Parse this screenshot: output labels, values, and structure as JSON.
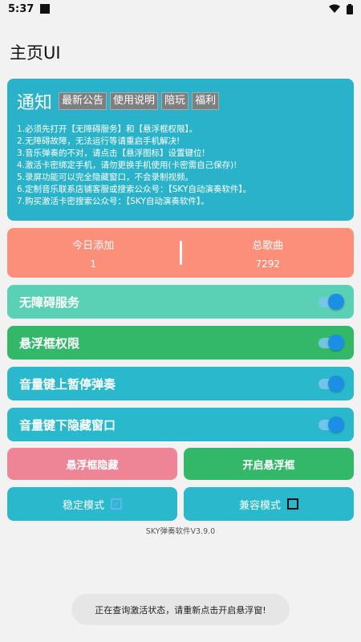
{
  "status_bar": {
    "time": "5:37",
    "icons": [
      "notification-square-icon",
      "wifi-icon",
      "battery-icon"
    ]
  },
  "app": {
    "title": "主页UI"
  },
  "notice": {
    "title": "通知",
    "tags": [
      "最新公告",
      "使用说明",
      "陪玩",
      "福利"
    ],
    "lines": [
      "1.必须先打开【无障碍服务】和【悬浮框权限】。",
      "2.无障碍故障，无法运行等请重启手机解决!",
      "3.音乐弹奏的不对，请点击【悬浮图标】设置键位!",
      "4.激活卡密绑定手机，请勿更换手机使用(卡密需自己保存)!",
      "5.录屏功能可以完全隐藏窗口，不会录制视频。",
      "6.定制音乐联系店铺客服或搜索公众号：【SKY自动演奏软件】。",
      "7.购买激活卡密搜索公众号：【SKY自动演奏软件】。"
    ],
    "color": "#29b2c9"
  },
  "stats": {
    "today_added_label": "今日添加",
    "today_added_value": "1",
    "total_songs_label": "总歌曲",
    "total_songs_value": "7292",
    "color": "#fb8f79"
  },
  "toggles": [
    {
      "label": "无障碍服务",
      "on": true,
      "color": "#5ad0b4"
    },
    {
      "label": "悬浮框权限",
      "on": true,
      "color": "#33b86a"
    },
    {
      "label": "音量键上暂停弹奏",
      "on": true,
      "color": "#29b8cc"
    },
    {
      "label": "音量键下隐藏窗口",
      "on": true,
      "color": "#29b8cc"
    }
  ],
  "buttons": {
    "hide_float": {
      "label": "悬浮框隐藏",
      "color": "#ee8597"
    },
    "open_float": {
      "label": "开启悬浮框",
      "color": "#33b86a"
    }
  },
  "modes": {
    "stable": {
      "label": "稳定模式",
      "checked": true
    },
    "compat": {
      "label": "兼容模式",
      "checked": false
    }
  },
  "version": "SKY弹奏软件V3.9.0",
  "toast": "正在查询激活状态，请重新点击开启悬浮窗!"
}
